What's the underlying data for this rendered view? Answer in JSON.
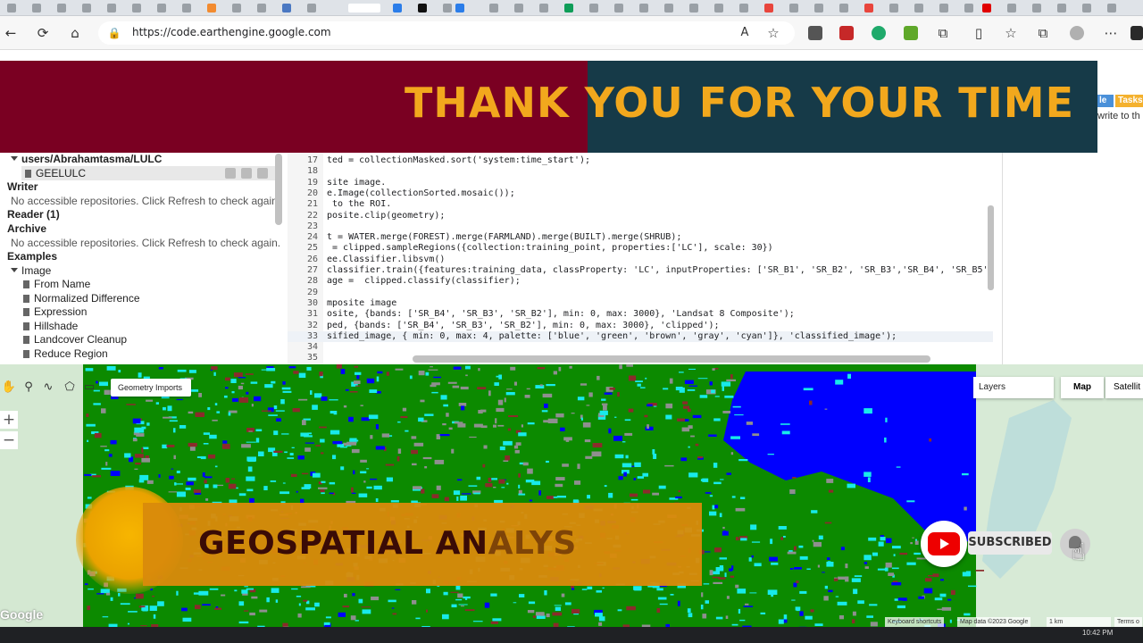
{
  "browser": {
    "url": "https://code.earthengine.google.com"
  },
  "banner": {
    "title": "THANK YOU FOR YOUR TIME",
    "colors": {
      "left": "#7a0022",
      "right": "#163a48",
      "text": "#f2a81d"
    }
  },
  "right_fragment": {
    "tab_fragment": "le",
    "tasks_tab": "Tasks",
    "text_fragment": "write to th"
  },
  "left_panel": {
    "repo_path": "users/Abrahamtasma/LULC",
    "repo_file": "GEELULC",
    "writer": "Writer",
    "writer_msg": "No accessible repositories. Click Refresh to check again.",
    "reader": "Reader (1)",
    "archive": "Archive",
    "archive_msg": "No accessible repositories. Click Refresh to check again.",
    "examples": "Examples",
    "image_folder": "Image",
    "image_items": [
      "From Name",
      "Normalized Difference",
      "Expression",
      "Hillshade",
      "Landcover Cleanup",
      "Reduce Region"
    ]
  },
  "editor": {
    "lines": [
      {
        "n": "17",
        "t": "ted = collectionMasked.sort('system:time_start');"
      },
      {
        "n": "18",
        "t": ""
      },
      {
        "n": "19",
        "t": "site image."
      },
      {
        "n": "20",
        "t": "e.Image(collectionSorted.mosaic());"
      },
      {
        "n": "21",
        "t": " to the ROI."
      },
      {
        "n": "22",
        "t": "posite.clip(geometry);"
      },
      {
        "n": "23",
        "t": ""
      },
      {
        "n": "24",
        "t": "t = WATER.merge(FOREST).merge(FARMLAND).merge(BUILT).merge(SHRUB);"
      },
      {
        "n": "25",
        "t": " = clipped.sampleRegions({collection:training_point, properties:['LC'], scale: 30})"
      },
      {
        "n": "26",
        "t": "ee.Classifier.libsvm()"
      },
      {
        "n": "27",
        "t": "classifier.train({features:training_data, classProperty: 'LC', inputProperties: ['SR_B1', 'SR_B2', 'SR_B3','SR_B4', 'SR_B5',"
      },
      {
        "n": "28",
        "t": "age =  clipped.classify(classifier);"
      },
      {
        "n": "29",
        "t": ""
      },
      {
        "n": "30",
        "t": "mposite image"
      },
      {
        "n": "31",
        "t": "osite, {bands: ['SR_B4', 'SR_B3', 'SR_B2'], min: 0, max: 3000}, 'Landsat 8 Composite');"
      },
      {
        "n": "32",
        "t": "ped, {bands: ['SR_B4', 'SR_B3', 'SR_B2'], min: 0, max: 3000}, 'clipped');"
      },
      {
        "n": "33",
        "t": "sified_image, { min: 0, max: 4, palette: ['blue', 'green', 'brown', 'gray', 'cyan']}, 'classified_image');"
      },
      {
        "n": "34",
        "t": ""
      },
      {
        "n": "35",
        "t": ""
      }
    ]
  },
  "map": {
    "geometry_imports": "Geometry Imports",
    "zoom_in": "+",
    "zoom_out": "−",
    "layers": "Layers",
    "map_type": "Map",
    "satellite_type": "Satellit",
    "google": "Google",
    "attr_shortcuts": "Keyboard shortcuts",
    "attr_data": "Map data ©2023 Google",
    "attr_scale": "1 km",
    "attr_terms": "Terms o",
    "palette": {
      "forest": "#0c8a00",
      "water": "#0000ff",
      "farmland": "#8b2b2b",
      "built": "#8f8f8f",
      "shrub": "#18eaea"
    }
  },
  "overlay": {
    "geo_text_main": "GEOSPATIAL AN",
    "geo_text_fade": "ALYS",
    "subscribed": "SUBSCRIBED",
    "hand_glyph": "☝"
  },
  "taskbar": {
    "clock": "10:42 PM"
  }
}
